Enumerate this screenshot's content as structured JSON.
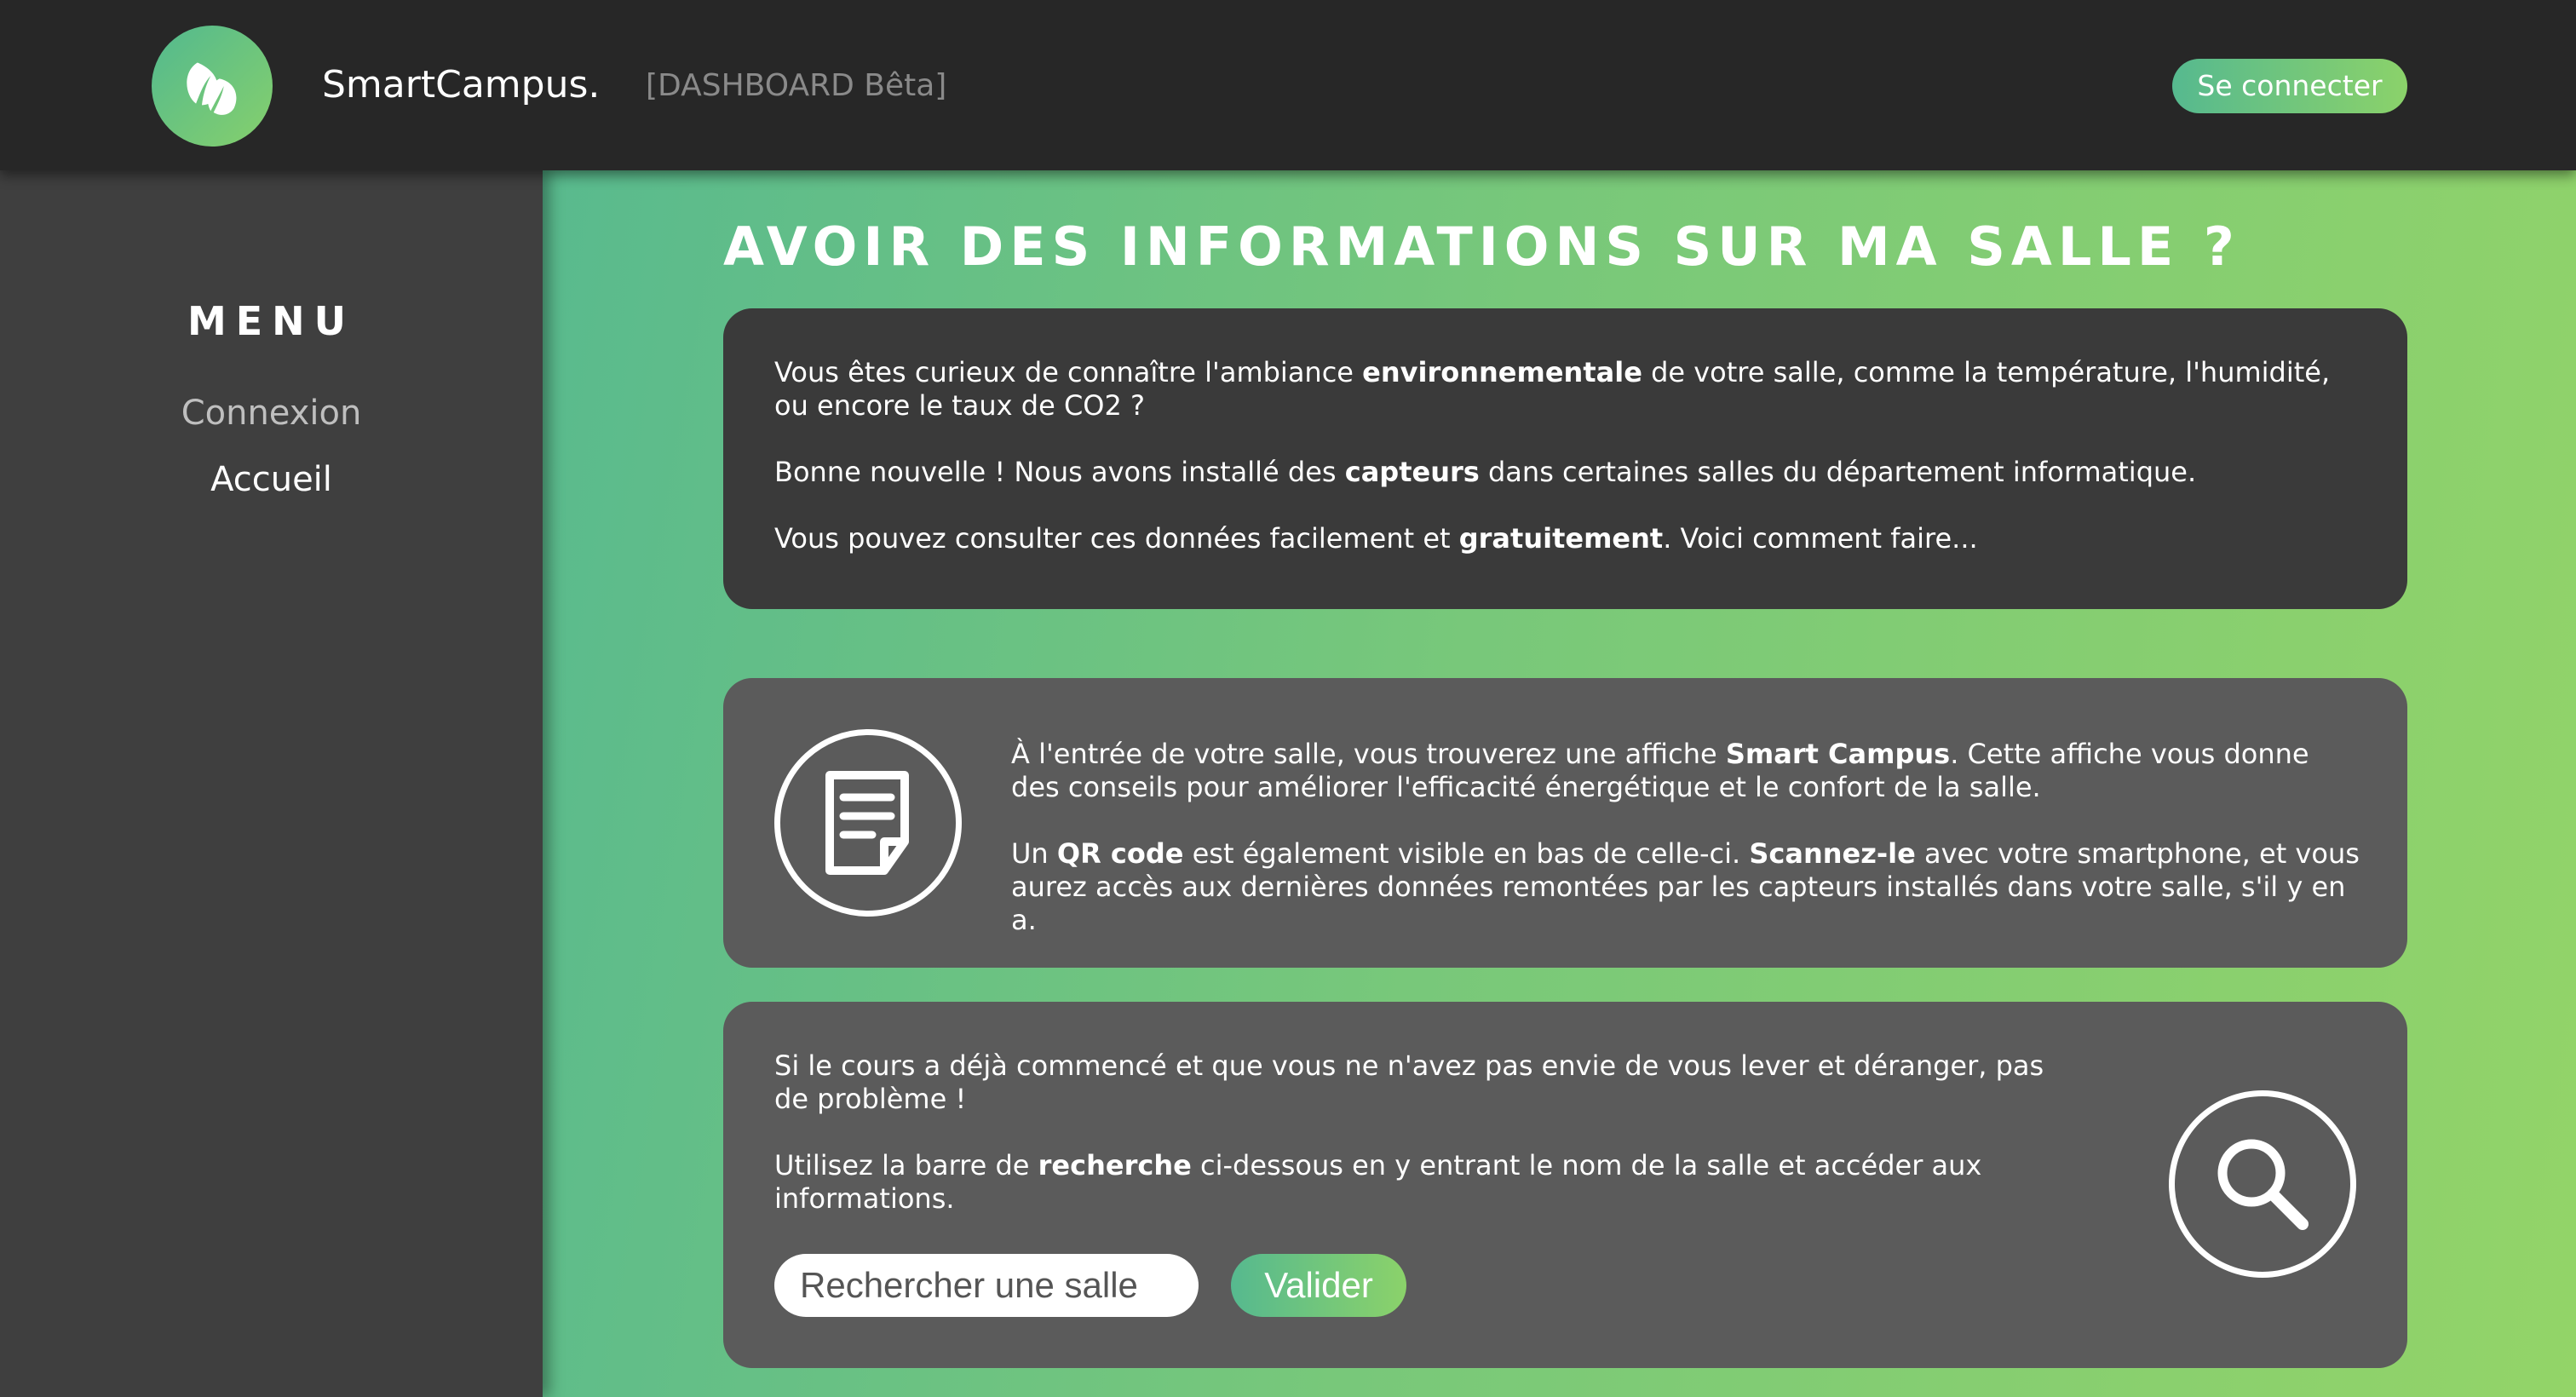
{
  "header": {
    "brand": "SmartCampus.",
    "beta_label": "[DASHBOARD Bêta]",
    "login_label": "Se connecter"
  },
  "sidebar": {
    "title": "MENU",
    "items": [
      {
        "label": "Connexion"
      },
      {
        "label": "Accueil"
      }
    ]
  },
  "main": {
    "title": "AVOIR DES INFORMATIONS SUR MA SALLE ?",
    "card1": {
      "p1": [
        "Vous êtes curieux de connaître l'ambiance ",
        "environnementale",
        " de votre salle, comme la température, l'humidité, ou encore le taux de CO2 ?"
      ],
      "p2": [
        "Bonne nouvelle ! Nous avons installé des ",
        "capteurs",
        " dans certaines salles du département informatique."
      ],
      "p3": [
        "Vous pouvez consulter ces données facilement et ",
        "gratuitement",
        ". Voici comment faire..."
      ]
    },
    "card2": {
      "icon": "document-icon",
      "p1": [
        "À l'entrée de votre salle, vous trouverez une affiche ",
        "Smart Campus",
        ". Cette affiche vous donne des conseils pour améliorer l'efficacité énergétique et le confort de la salle."
      ],
      "p2": [
        "Un ",
        "QR code",
        " est également visible en bas de celle-ci. ",
        "Scannez-le",
        " avec votre smartphone, et vous aurez accès aux dernières données remontées par les capteurs installés dans votre salle, s'il y en a."
      ]
    },
    "card3": {
      "icon": "search-icon",
      "p1": "Si le cours a déjà commencé et que vous ne n'avez pas envie de vous lever et déranger, pas de problème !",
      "p2": [
        "Utilisez la barre de ",
        "recherche",
        " ci-dessous en y entrant le nom de la salle et accéder aux informations."
      ],
      "search_placeholder": "Rechercher une salle",
      "submit_label": "Valider"
    }
  },
  "colors": {
    "header_bg": "#272727",
    "sidebar_bg": "#3f3f3f",
    "accent_start": "#56b98f",
    "accent_end": "#8bd26a"
  }
}
